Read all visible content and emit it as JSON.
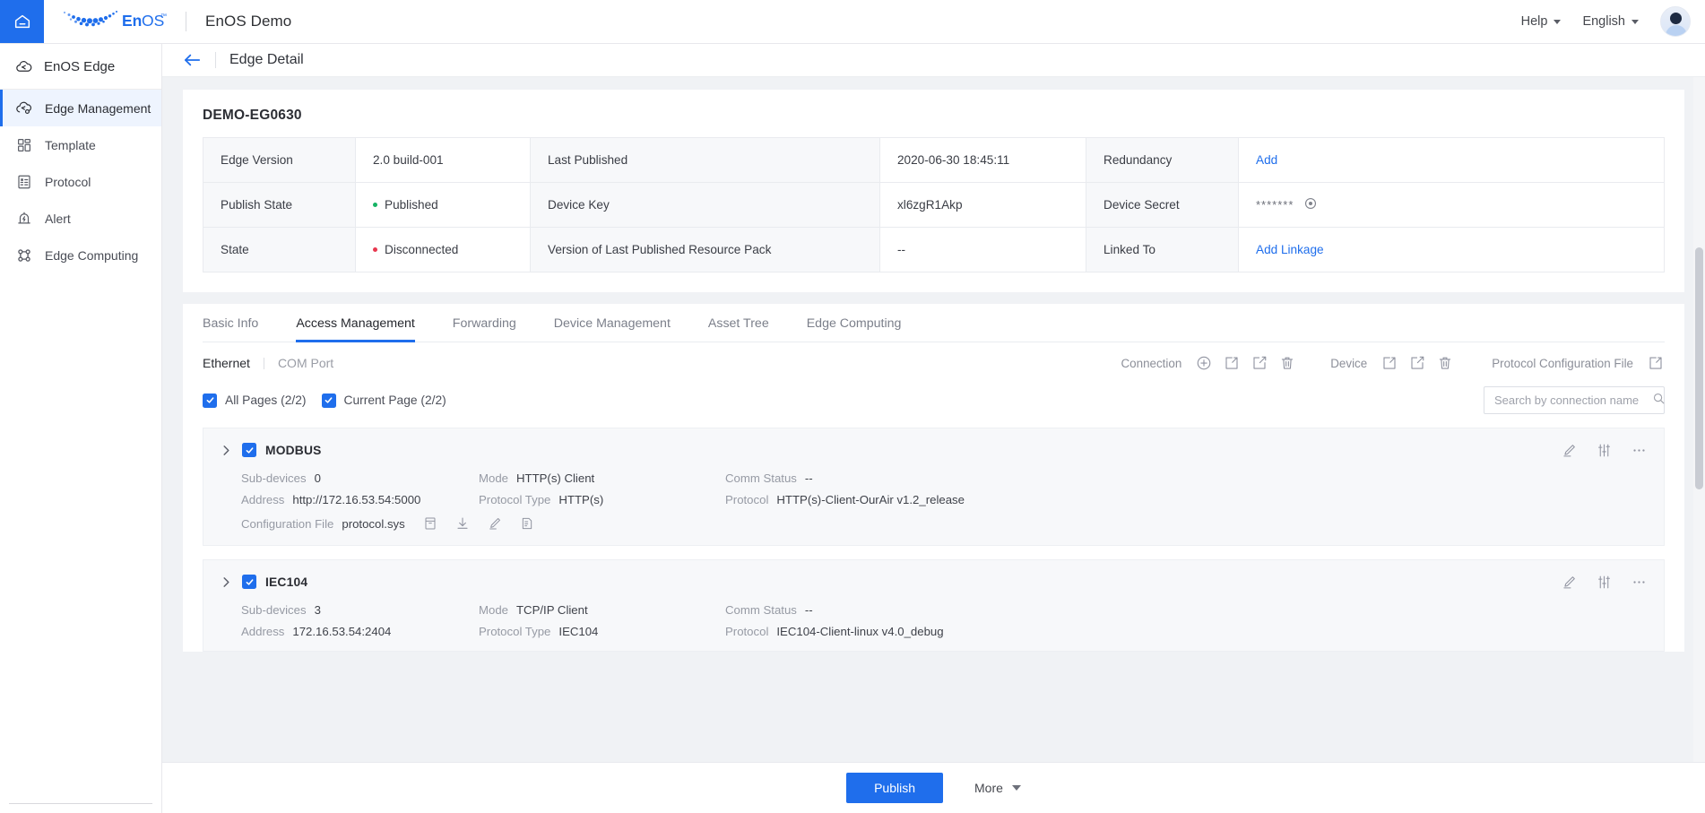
{
  "topbar": {
    "home_icon": "home-icon",
    "brand_name": "EnOS",
    "brand_tm": "™",
    "app_title": "EnOS Demo",
    "help_label": "Help",
    "language_label": "English"
  },
  "sidebar": {
    "header": {
      "label": "EnOS Edge",
      "icon": "edge-cloud-icon"
    },
    "items": [
      {
        "label": "Edge Management",
        "icon": "edge-management-icon",
        "active": true
      },
      {
        "label": "Template",
        "icon": "template-grid-icon",
        "active": false
      },
      {
        "label": "Protocol",
        "icon": "protocol-list-icon",
        "active": false
      },
      {
        "label": "Alert",
        "icon": "alert-bell-icon",
        "active": false
      },
      {
        "label": "Edge Computing",
        "icon": "edge-computing-nodes-icon",
        "active": false
      }
    ]
  },
  "page_header": {
    "back_icon": "back-arrow-icon",
    "title": "Edge Detail"
  },
  "detail": {
    "name": "DEMO-EG0630",
    "rows": [
      {
        "label1": "Edge Version",
        "value1": "2.0 build-001",
        "value1_type": "text",
        "label2": "Last Published",
        "value2": "2020-06-30 18:45:11",
        "value2_type": "text",
        "label3": "Redundancy",
        "value3": "Add",
        "value3_type": "link"
      },
      {
        "label1": "Publish State",
        "value1": "Published",
        "value1_type": "status-green",
        "label2": "Device Key",
        "value2": "xl6zgR1Akp",
        "value2_type": "text",
        "label3": "Device Secret",
        "value3": "*******",
        "value3_type": "secret"
      },
      {
        "label1": "State",
        "value1": "Disconnected",
        "value1_type": "status-red",
        "label2": "Version of Last Published Resource Pack",
        "value2": "--",
        "value2_type": "text",
        "label3": "Linked To",
        "value3": "Add Linkage",
        "value3_type": "link"
      }
    ],
    "eye_icon": "eye-reveal-icon"
  },
  "tabs": [
    {
      "label": "Basic Info",
      "active": false
    },
    {
      "label": "Access Management",
      "active": true
    },
    {
      "label": "Forwarding",
      "active": false
    },
    {
      "label": "Device Management",
      "active": false
    },
    {
      "label": "Asset Tree",
      "active": false
    },
    {
      "label": "Edge Computing",
      "active": false
    }
  ],
  "access": {
    "sub_tabs": [
      {
        "label": "Ethernet",
        "active": true
      },
      {
        "label": "COM Port",
        "active": false
      }
    ],
    "toolbar": {
      "connection_label": "Connection",
      "connection_icons": [
        "add-circle-icon",
        "import-icon",
        "export-icon",
        "delete-trash-icon"
      ],
      "device_label": "Device",
      "device_icons": [
        "import-icon",
        "export-icon",
        "delete-trash-icon"
      ],
      "protocol_file_label": "Protocol Configuration File",
      "protocol_file_icons": [
        "import-icon"
      ]
    },
    "filters": {
      "all_pages_label": "All Pages (2/2)",
      "current_page_label": "Current Page (2/2)",
      "search_placeholder": "Search by connection name",
      "search_value": "",
      "search_icon": "search-icon"
    },
    "cards": [
      {
        "name": "MODBUS",
        "checked": true,
        "expand_icon": "chevron-right-icon",
        "actions": [
          "edit-pencil-icon",
          "settings-sliders-icon",
          "more-ellipsis-icon"
        ],
        "fields": {
          "sub_devices_label": "Sub-devices",
          "sub_devices_value": "0",
          "address_label": "Address",
          "address_value": "http://172.16.53.54:5000",
          "mode_label": "Mode",
          "mode_value": "HTTP(s) Client",
          "protocol_type_label": "Protocol Type",
          "protocol_type_value": "HTTP(s)",
          "comm_status_label": "Comm Status",
          "comm_status_value": "--",
          "protocol_label": "Protocol",
          "protocol_value": "HTTP(s)-Client-OurAir v1.2_release"
        },
        "config_file": {
          "label": "Configuration File",
          "value": "protocol.sys",
          "icons": [
            "archive-box-icon",
            "download-icon",
            "edit-pencil-icon",
            "document-edit-icon"
          ]
        }
      },
      {
        "name": "IEC104",
        "checked": true,
        "expand_icon": "chevron-right-icon",
        "actions": [
          "edit-pencil-icon",
          "settings-sliders-icon",
          "more-ellipsis-icon"
        ],
        "fields": {
          "sub_devices_label": "Sub-devices",
          "sub_devices_value": "3",
          "address_label": "Address",
          "address_value": "172.16.53.54:2404",
          "mode_label": "Mode",
          "mode_value": "TCP/IP Client",
          "protocol_type_label": "Protocol Type",
          "protocol_type_value": "IEC104",
          "comm_status_label": "Comm Status",
          "comm_status_value": "--",
          "protocol_label": "Protocol",
          "protocol_value": "IEC104-Client-linux v4.0_debug"
        },
        "config_file": null
      }
    ]
  },
  "footer": {
    "publish_label": "Publish",
    "more_label": "More"
  },
  "colors": {
    "accent": "#1f6eec",
    "status_green": "#16b364",
    "status_red": "#e8384f",
    "page_bg": "#f0f2f5"
  }
}
